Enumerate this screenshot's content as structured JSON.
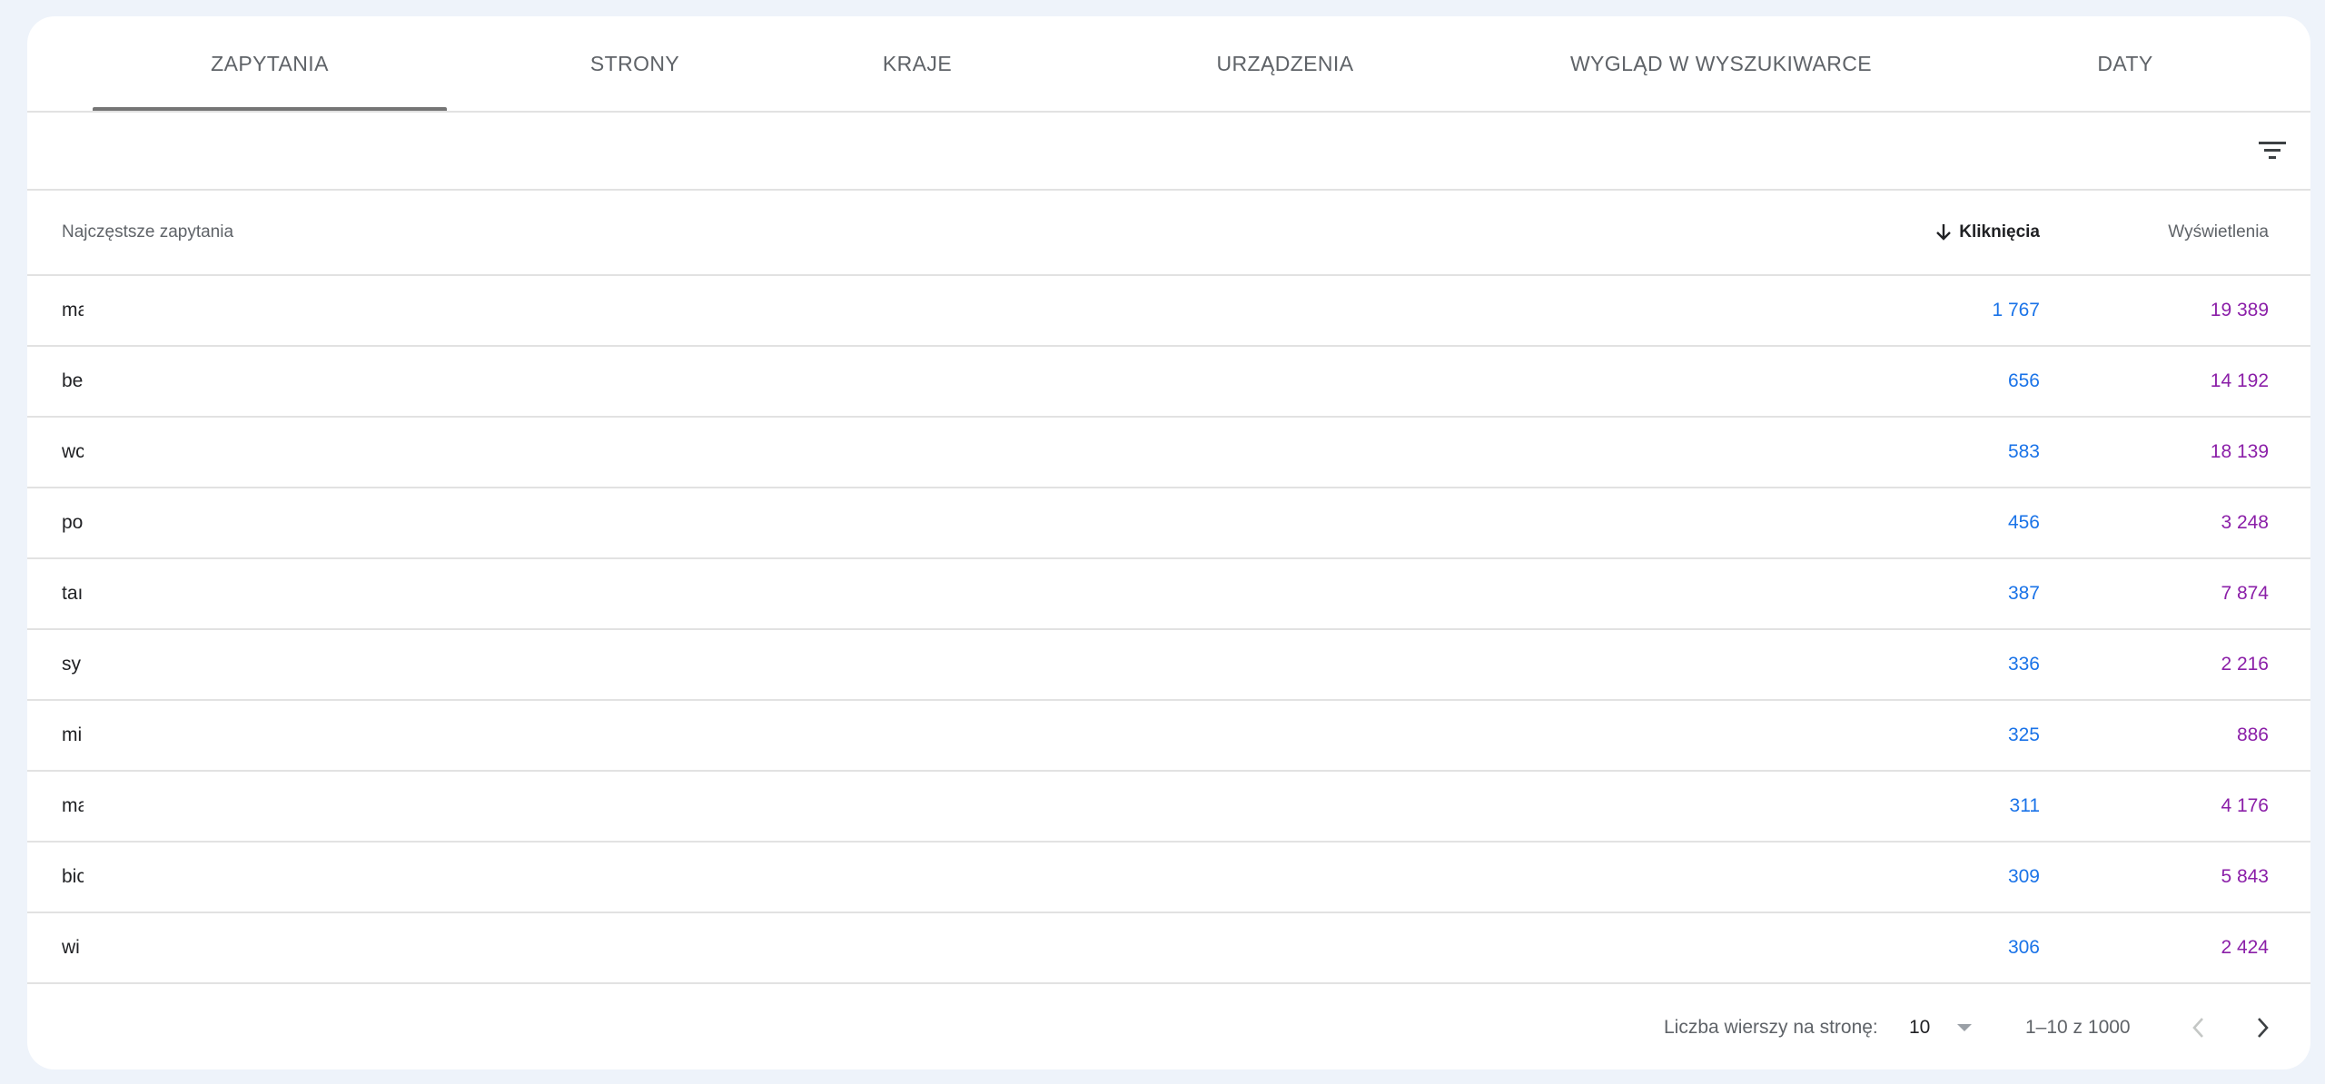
{
  "tabs": [
    {
      "label": "ZAPYTANIA",
      "active": true
    },
    {
      "label": "STRONY",
      "active": false
    },
    {
      "label": "KRAJE",
      "active": false
    },
    {
      "label": "URZĄDZENIA",
      "active": false
    },
    {
      "label": "WYGLĄD W WYSZUKIWARCE",
      "active": false
    },
    {
      "label": "DATY",
      "active": false
    }
  ],
  "filter": {
    "icon": "filter-list-icon"
  },
  "table": {
    "headers": {
      "query": "Najczęstsze zapytania",
      "clicks": "Kliknięcia",
      "impressions": "Wyświetlenia"
    },
    "sort": {
      "column": "clicks",
      "direction": "descending",
      "icon": "arrow-down-icon"
    },
    "rows": [
      {
        "query": "ma",
        "clicks": "1 767",
        "impressions": "19 389"
      },
      {
        "query": "be",
        "clicks": "656",
        "impressions": "14 192"
      },
      {
        "query": "wc",
        "clicks": "583",
        "impressions": "18 139"
      },
      {
        "query": "po",
        "clicks": "456",
        "impressions": "3 248"
      },
      {
        "query": "taı",
        "clicks": "387",
        "impressions": "7 874"
      },
      {
        "query": "sy",
        "clicks": "336",
        "impressions": "2 216"
      },
      {
        "query": "mi",
        "clicks": "325",
        "impressions": "886"
      },
      {
        "query": "ma",
        "clicks": "311",
        "impressions": "4 176"
      },
      {
        "query": "bic",
        "clicks": "309",
        "impressions": "5 843"
      },
      {
        "query": "wi",
        "clicks": "306",
        "impressions": "2 424"
      }
    ]
  },
  "pagination": {
    "rows_per_page_label": "Liczba wierszy na stronę:",
    "rows_per_page_value": "10",
    "range": "1–10 z 1000",
    "prev_icon": "chevron-left-icon",
    "next_icon": "chevron-right-icon"
  },
  "colors": {
    "clicks": "#1a73e8",
    "impressions": "#8b1fa8",
    "background": "#eef3fa"
  }
}
